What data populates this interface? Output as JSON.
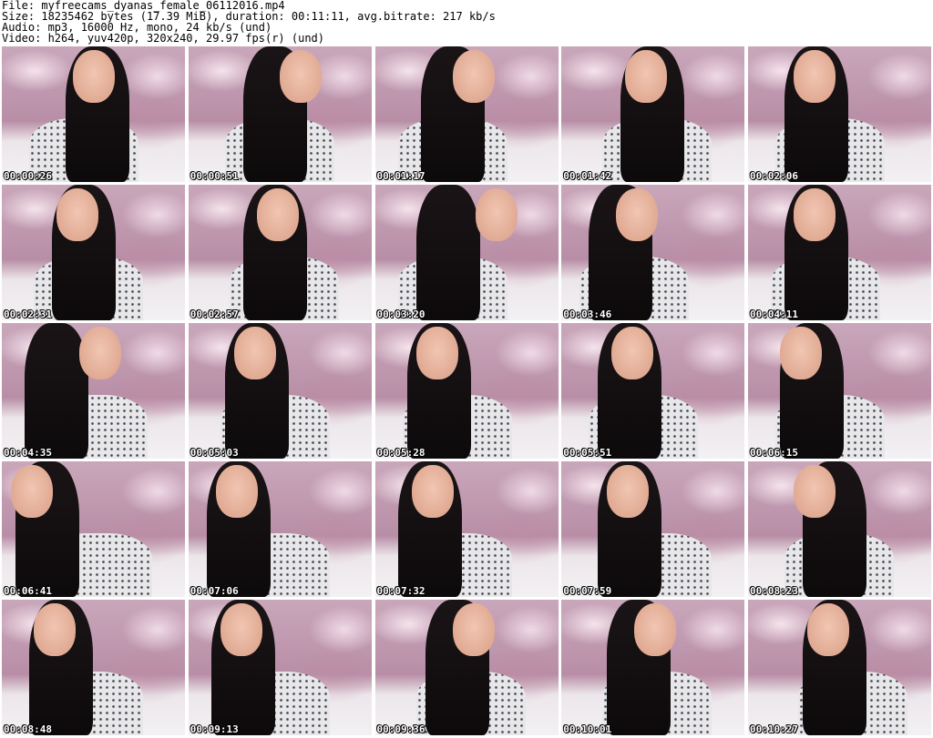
{
  "header": {
    "file_line": "File: myfreecams_dyanas_female_06112016.mp4",
    "size_line": "Size: 18235462 bytes (17.39 MiB), duration: 00:11:11, avg.bitrate: 217 kb/s",
    "audio_line": "Audio: mp3, 16000 Hz, mono, 24 kb/s (und)",
    "video_line": "Video: h264, yuv420p, 320x240, 29.97 fps(r) (und)"
  },
  "thumbnails": [
    {
      "timestamp": "00:00:26"
    },
    {
      "timestamp": "00:00:51"
    },
    {
      "timestamp": "00:01:17"
    },
    {
      "timestamp": "00:01:42"
    },
    {
      "timestamp": "00:02:06"
    },
    {
      "timestamp": "00:02:31"
    },
    {
      "timestamp": "00:02:57"
    },
    {
      "timestamp": "00:03:20"
    },
    {
      "timestamp": "00:03:46"
    },
    {
      "timestamp": "00:04:11"
    },
    {
      "timestamp": "00:04:35"
    },
    {
      "timestamp": "00:05:03"
    },
    {
      "timestamp": "00:05:28"
    },
    {
      "timestamp": "00:05:51"
    },
    {
      "timestamp": "00:06:15"
    },
    {
      "timestamp": "00:06:41"
    },
    {
      "timestamp": "00:07:06"
    },
    {
      "timestamp": "00:07:32"
    },
    {
      "timestamp": "00:07:59"
    },
    {
      "timestamp": "00:08:23"
    },
    {
      "timestamp": "00:08:48"
    },
    {
      "timestamp": "00:09:13"
    },
    {
      "timestamp": "00:09:36"
    },
    {
      "timestamp": "00:10:01"
    },
    {
      "timestamp": "00:10:27"
    }
  ]
}
